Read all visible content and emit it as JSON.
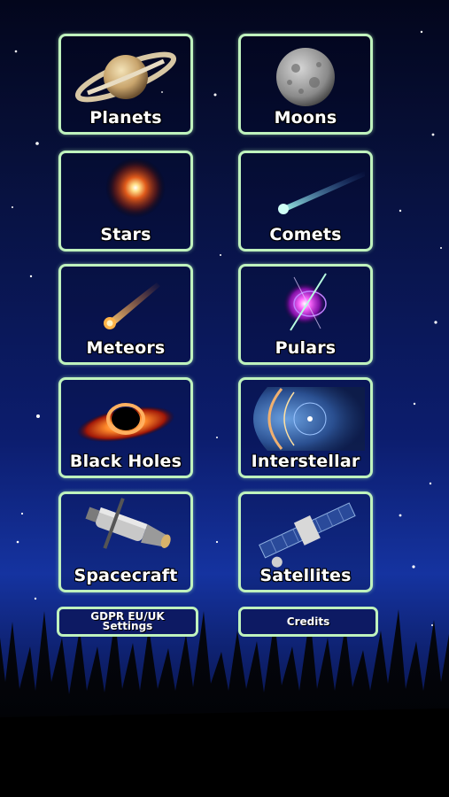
{
  "menu": {
    "tiles": [
      {
        "label": "Planets",
        "icon": "saturn-icon"
      },
      {
        "label": "Moons",
        "icon": "moon-icon"
      },
      {
        "label": "Stars",
        "icon": "star-icon"
      },
      {
        "label": "Comets",
        "icon": "comet-icon"
      },
      {
        "label": "Meteors",
        "icon": "meteor-icon"
      },
      {
        "label": "Pulars",
        "icon": "pulsar-icon"
      },
      {
        "label": "Black Holes",
        "icon": "black-hole-icon"
      },
      {
        "label": "Interstellar",
        "icon": "heliosphere-icon"
      },
      {
        "label": "Spacecraft",
        "icon": "spacecraft-icon"
      },
      {
        "label": "Satellites",
        "icon": "satellite-icon"
      }
    ],
    "gdpr": {
      "line1": "GDPR EU/UK",
      "line2": "Settings"
    },
    "credits": "Credits"
  },
  "colors": {
    "tile_border": "#bff2bd",
    "sky_top": "#03061c",
    "sky_mid": "#1533a0",
    "grass": "#000000"
  }
}
